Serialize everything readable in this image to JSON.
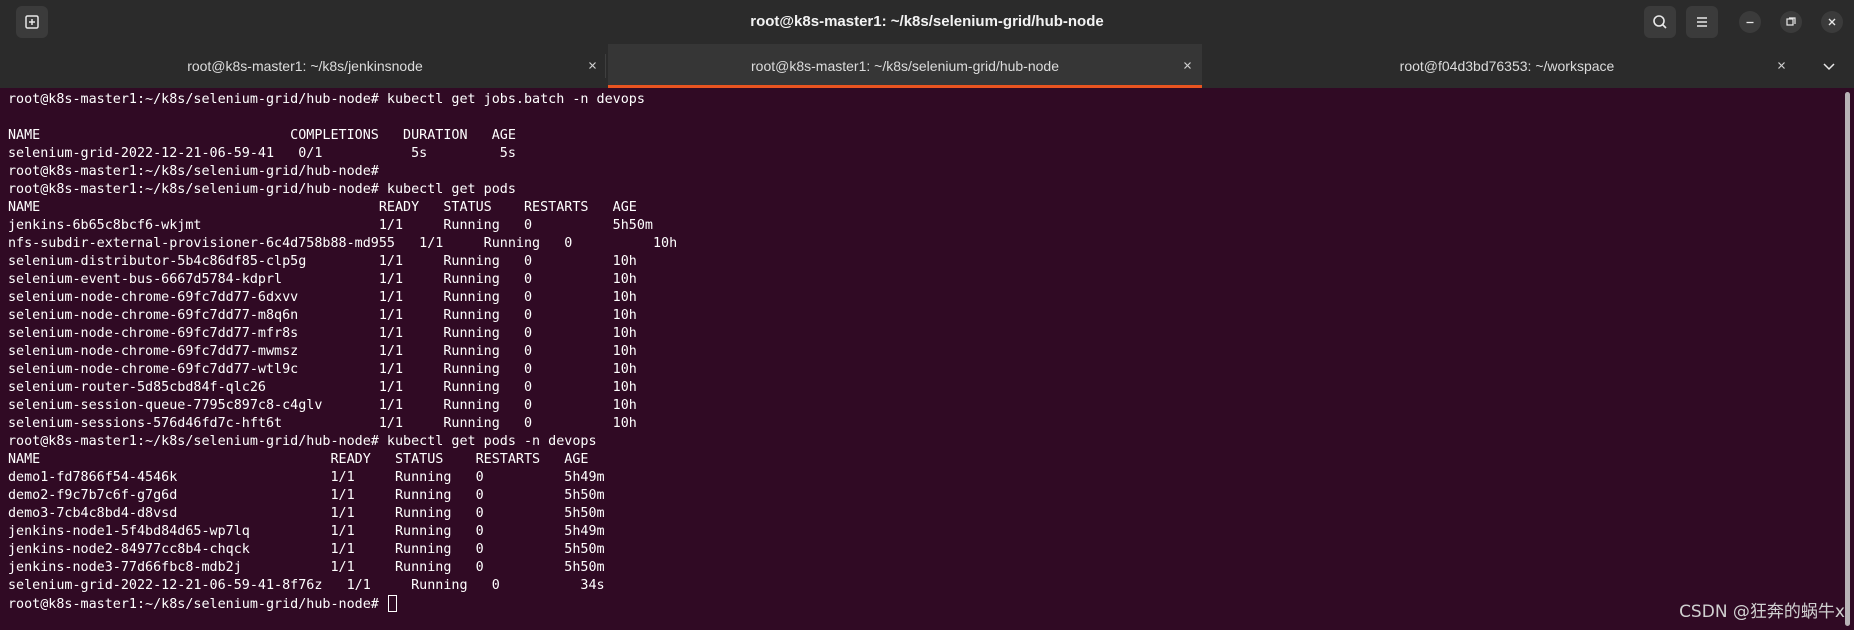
{
  "window": {
    "title": "root@k8s-master1: ~/k8s/selenium-grid/hub-node",
    "buttons": {
      "new_tab_icon": "new-tab-icon",
      "search_icon": "search-icon",
      "menu_icon": "hamburger-menu-icon",
      "minimize_icon": "minimize-icon",
      "maximize_icon": "maximize-icon",
      "close_icon": "close-icon"
    }
  },
  "tabs": [
    {
      "label": "root@k8s-master1: ~/k8s/jenkinsnode",
      "active": false
    },
    {
      "label": "root@k8s-master1: ~/k8s/selenium-grid/hub-node",
      "active": true
    },
    {
      "label": "root@f04d3bd76353: ~/workspace",
      "active": false
    }
  ],
  "terminal": {
    "lines": [
      "root@k8s-master1:~/k8s/selenium-grid/hub-node# kubectl get jobs.batch -n devops",
      "",
      "NAME                               COMPLETIONS   DURATION   AGE",
      "selenium-grid-2022-12-21-06-59-41   0/1           5s         5s",
      "root@k8s-master1:~/k8s/selenium-grid/hub-node#",
      "root@k8s-master1:~/k8s/selenium-grid/hub-node# kubectl get pods",
      "NAME                                          READY   STATUS    RESTARTS   AGE",
      "jenkins-6b65c8bcf6-wkjmt                      1/1     Running   0          5h50m",
      "nfs-subdir-external-provisioner-6c4d758b88-md955   1/1     Running   0          10h",
      "selenium-distributor-5b4c86df85-clp5g         1/1     Running   0          10h",
      "selenium-event-bus-6667d5784-kdprl            1/1     Running   0          10h",
      "selenium-node-chrome-69fc7dd77-6dxvv          1/1     Running   0          10h",
      "selenium-node-chrome-69fc7dd77-m8q6n          1/1     Running   0          10h",
      "selenium-node-chrome-69fc7dd77-mfr8s          1/1     Running   0          10h",
      "selenium-node-chrome-69fc7dd77-mwmsz          1/1     Running   0          10h",
      "selenium-node-chrome-69fc7dd77-wtl9c          1/1     Running   0          10h",
      "selenium-router-5d85cbd84f-qlc26              1/1     Running   0          10h",
      "selenium-session-queue-7795c897c8-c4glv       1/1     Running   0          10h",
      "selenium-sessions-576d46fd7c-hft6t            1/1     Running   0          10h",
      "root@k8s-master1:~/k8s/selenium-grid/hub-node# kubectl get pods -n devops",
      "NAME                                    READY   STATUS    RESTARTS   AGE",
      "demo1-fd7866f54-4546k                   1/1     Running   0          5h49m",
      "demo2-f9c7b7c6f-g7g6d                   1/1     Running   0          5h50m",
      "demo3-7cb4c8bd4-d8vsd                   1/1     Running   0          5h50m",
      "jenkins-node1-5f4bd84d65-wp7lq          1/1     Running   0          5h49m",
      "jenkins-node2-84977cc8b4-chqck          1/1     Running   0          5h50m",
      "jenkins-node3-77d66fbc8-mdb2j           1/1     Running   0          5h50m",
      "selenium-grid-2022-12-21-06-59-41-8f76z   1/1     Running   0          34s"
    ],
    "prompt": "root@k8s-master1:~/k8s/selenium-grid/hub-node# "
  },
  "watermark": "CSDN @狂奔的蜗牛x",
  "colors": {
    "terminal_bg": "#300a24",
    "chrome_bg": "#2b2b2b",
    "accent": "#e95420",
    "text": "#ffffff"
  }
}
